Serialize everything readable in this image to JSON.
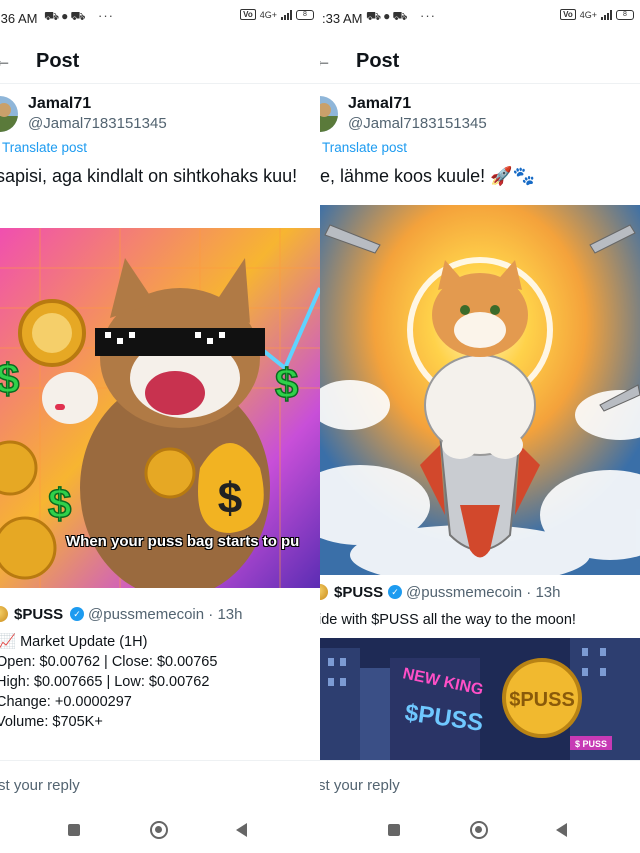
{
  "panels": [
    {
      "status": {
        "time": ":36 AM",
        "net": "4G+",
        "battery": "8"
      },
      "header": {
        "back": "←",
        "title": "Post"
      },
      "author": {
        "name": "Jamal71",
        "handle": "@Jamal7183151345"
      },
      "translate": "Translate post",
      "text": "sapisi, aga kindlalt on sihtkohaks kuu!",
      "image_caption": "When your puss bag starts to pu",
      "quote": {
        "name": "$PUSS",
        "handle": "@pussmemecoin",
        "time": "· 13h",
        "lines": [
          "📈 Market Update (1H)",
          "Open: $0.00762 | Close: $0.00765",
          "High: $0.007665 | Low: $0.00762",
          "Change: +0.0000297",
          "Volume: $705K+"
        ]
      },
      "reply_placeholder": "st your reply"
    },
    {
      "status": {
        "time": ":33 AM",
        "net": "4G+",
        "battery": "8"
      },
      "header": {
        "back": "←",
        "title": "Post"
      },
      "author": {
        "name": "Jamal71",
        "handle": "@Jamal7183151345"
      },
      "translate": "Translate post",
      "text": "le, lähme koos kuule! 🚀🐾",
      "quote": {
        "name": "$PUSS",
        "handle": "@pussmemecoin",
        "time": "· 13h",
        "lines": [
          "ide with $PUSS all the way to the moon!"
        ],
        "image_text": {
          "sign": "NEW KING",
          "brand": "$PUSS",
          "coin": "$PUSS",
          "tag": "$ PUSS"
        }
      },
      "reply_placeholder": "st your reply"
    }
  ],
  "icons": {
    "status_left": [
      "carrier-icon",
      "chat-icon",
      "location-icon",
      "more-dots-icon"
    ],
    "nav": [
      "recent-apps-icon",
      "home-icon",
      "back-icon"
    ],
    "verified": "verified-check-icon"
  },
  "colors": {
    "link": "#1d9bf0",
    "secondary_text": "#536471",
    "verified": "#1d9bf0"
  }
}
